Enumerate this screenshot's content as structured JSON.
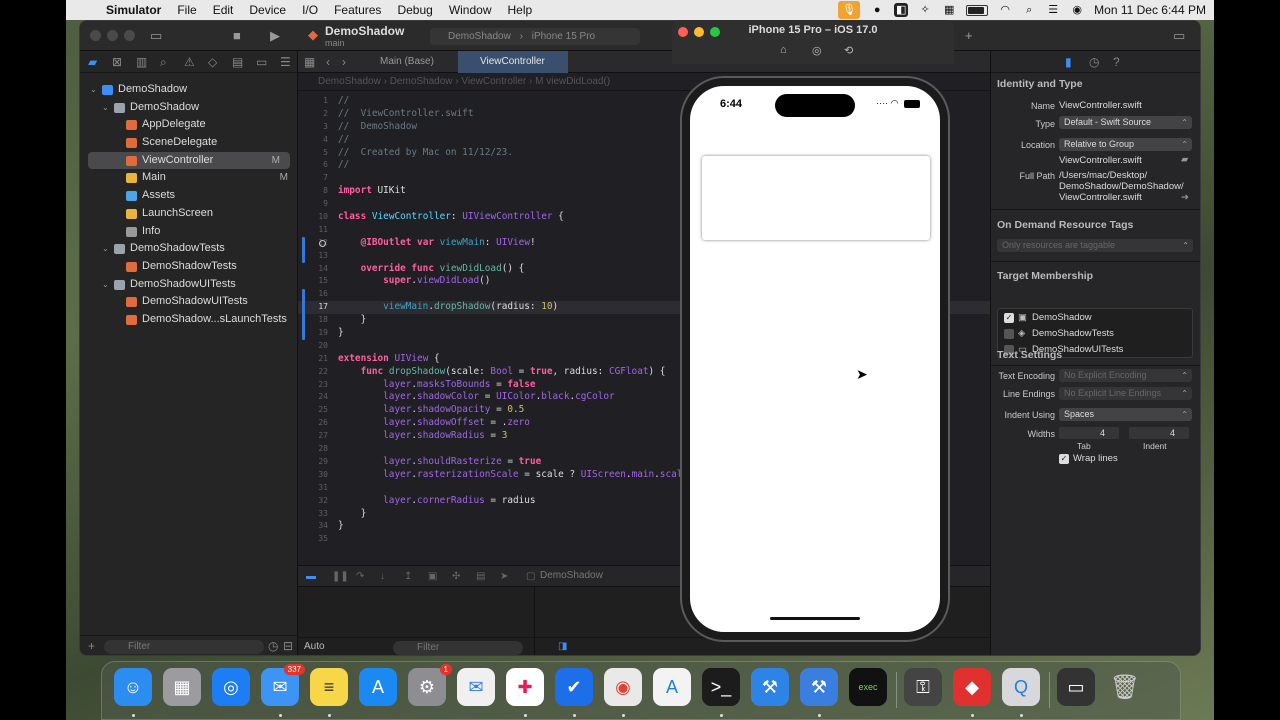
{
  "menubar": {
    "app_name": "Simulator",
    "items": [
      "File",
      "Edit",
      "Device",
      "I/O",
      "Features",
      "Debug",
      "Window",
      "Help"
    ],
    "clock": "Mon 11 Dec  6:44 PM"
  },
  "xcode": {
    "project_title": "DemoShadow",
    "branch": "main",
    "scheme": "DemoShadow",
    "destination": "iPhone 15 Pro"
  },
  "navigator": {
    "filter_placeholder": "Filter",
    "items": [
      {
        "label": "DemoShadow",
        "level": 0,
        "kind": "project",
        "expanded": true,
        "badge": ""
      },
      {
        "label": "DemoShadow",
        "level": 1,
        "kind": "folder",
        "expanded": true,
        "badge": ""
      },
      {
        "label": "AppDelegate",
        "level": 2,
        "kind": "swift",
        "badge": ""
      },
      {
        "label": "SceneDelegate",
        "level": 2,
        "kind": "swift",
        "badge": ""
      },
      {
        "label": "ViewController",
        "level": 2,
        "kind": "swift",
        "badge": "M",
        "selected": true
      },
      {
        "label": "Main",
        "level": 2,
        "kind": "storyboard",
        "badge": "M"
      },
      {
        "label": "Assets",
        "level": 2,
        "kind": "assets",
        "badge": ""
      },
      {
        "label": "LaunchScreen",
        "level": 2,
        "kind": "storyboard",
        "badge": ""
      },
      {
        "label": "Info",
        "level": 2,
        "kind": "plist",
        "badge": ""
      },
      {
        "label": "DemoShadowTests",
        "level": 1,
        "kind": "folder",
        "expanded": true,
        "badge": ""
      },
      {
        "label": "DemoShadowTests",
        "level": 2,
        "kind": "swift",
        "badge": ""
      },
      {
        "label": "DemoShadowUITests",
        "level": 1,
        "kind": "folder",
        "expanded": true,
        "badge": ""
      },
      {
        "label": "DemoShadowUITests",
        "level": 2,
        "kind": "swift",
        "badge": ""
      },
      {
        "label": "DemoShadow...sLaunchTests",
        "level": 2,
        "kind": "swift",
        "badge": ""
      }
    ]
  },
  "editor": {
    "tabs": [
      {
        "label": "Main (Base)",
        "active": false
      },
      {
        "label": "ViewController",
        "active": true
      }
    ],
    "jumpbar": "DemoShadow  ›  DemoShadow  ›  ViewController  ›  M  viewDidLoad()",
    "debug_scheme": "DemoShadow",
    "debug_filter_mode": "Auto",
    "debug_filter_placeholder": "Filter",
    "code_lines": [
      {
        "n": "1",
        "html": "<span class='cm'>//</span>"
      },
      {
        "n": "2",
        "html": "<span class='cm'>//  ViewController.swift</span>"
      },
      {
        "n": "3",
        "html": "<span class='cm'>//  DemoShadow</span>"
      },
      {
        "n": "4",
        "html": "<span class='cm'>//</span>"
      },
      {
        "n": "5",
        "html": "<span class='cm'>//  Created by Mac on 11/12/23.</span>"
      },
      {
        "n": "6",
        "html": "<span class='cm'>//</span>"
      },
      {
        "n": "7",
        "html": ""
      },
      {
        "n": "8",
        "html": "<span class='kw'>import</span> UIKit"
      },
      {
        "n": "9",
        "html": ""
      },
      {
        "n": "10",
        "html": "<span class='kw'>class</span> <span class='ty'>ViewController</span>: <span class='pr'>UIViewController</span> {"
      },
      {
        "n": "11",
        "html": ""
      },
      {
        "n": "12",
        "html": "    <span class='kw'>@IBOutlet</span> <span class='kw'>var</span> <span class='ou'>viewMain</span>: <span class='pr'>UIView</span>!",
        "outlet": true
      },
      {
        "n": "13",
        "html": ""
      },
      {
        "n": "14",
        "html": "    <span class='kw'>override</span> <span class='kw'>func</span> <span class='fn'>viewDidLoad</span>() {"
      },
      {
        "n": "15",
        "html": "        <span class='kw'>super</span>.<span class='pr'>viewDidLoad</span>()"
      },
      {
        "n": "16",
        "html": ""
      },
      {
        "n": "17",
        "html": "        <span class='ou'>viewMain</span>.<span class='fn'>dropShadow</span>(radius: <span class='nu'>10</span>)",
        "current": true
      },
      {
        "n": "18",
        "html": "    }"
      },
      {
        "n": "19",
        "html": "}"
      },
      {
        "n": "20",
        "html": ""
      },
      {
        "n": "21",
        "html": "<span class='kw'>extension</span> <span class='pr'>UIView</span> {"
      },
      {
        "n": "22",
        "html": "    <span class='kw'>func</span> <span class='fn'>dropShadow</span>(scale: <span class='pr'>Bool</span> = <span class='kw'>true</span>, radius: <span class='pr'>CGFloat</span>) {"
      },
      {
        "n": "23",
        "html": "        <span class='pr'>layer</span>.<span class='pr'>masksToBounds</span> = <span class='kw'>false</span>"
      },
      {
        "n": "24",
        "html": "        <span class='pr'>layer</span>.<span class='pr'>shadowColor</span> = <span class='pr'>UIColor</span>.<span class='pr'>black</span>.<span class='pr'>cgColor</span>"
      },
      {
        "n": "25",
        "html": "        <span class='pr'>layer</span>.<span class='pr'>shadowOpacity</span> = <span class='nu'>0.5</span>"
      },
      {
        "n": "26",
        "html": "        <span class='pr'>layer</span>.<span class='pr'>shadowOffset</span> = .<span class='pr'>zero</span>"
      },
      {
        "n": "27",
        "html": "        <span class='pr'>layer</span>.<span class='pr'>shadowRadius</span> = <span class='nu'>3</span>"
      },
      {
        "n": "28",
        "html": ""
      },
      {
        "n": "29",
        "html": "        <span class='pr'>layer</span>.<span class='pr'>shouldRasterize</span> = <span class='kw'>true</span>"
      },
      {
        "n": "30",
        "html": "        <span class='pr'>layer</span>.<span class='pr'>rasterizationScale</span> = scale ? <span class='pr'>UIScreen</span>.<span class='pr'>main</span>.<span class='pr'>scale</span>"
      },
      {
        "n": "31",
        "html": ""
      },
      {
        "n": "32",
        "html": "        <span class='pr'>layer</span>.<span class='pr'>cornerRadius</span> = radius"
      },
      {
        "n": "33",
        "html": "    }"
      },
      {
        "n": "34",
        "html": "}"
      },
      {
        "n": "35",
        "html": ""
      }
    ]
  },
  "inspector": {
    "identity_title": "Identity and Type",
    "name_label": "Name",
    "name_value": "ViewController.swift",
    "type_label": "Type",
    "type_value": "Default - Swift Source",
    "location_label": "Location",
    "location_value": "Relative to Group",
    "location_file": "ViewController.swift",
    "fullpath_label": "Full Path",
    "fullpath_line1": "/Users/mac/Desktop/",
    "fullpath_line2": "DemoShadow/DemoShadow/",
    "fullpath_line3": "ViewController.swift",
    "odr_title": "On Demand Resource Tags",
    "odr_placeholder": "Only resources are taggable",
    "membership_title": "Target Membership",
    "membership": [
      {
        "label": "DemoShadow",
        "checked": true
      },
      {
        "label": "DemoShadowTests",
        "checked": false
      },
      {
        "label": "DemoShadowUITests",
        "checked": false
      }
    ],
    "text_settings_title": "Text Settings",
    "encoding_label": "Text Encoding",
    "encoding_value": "No Explicit Encoding",
    "line_endings_label": "Line Endings",
    "line_endings_value": "No Explicit Line Endings",
    "indent_using_label": "Indent Using",
    "indent_using_value": "Spaces",
    "widths_label": "Widths",
    "tab_value": "4",
    "indent_value": "4",
    "tab_caption": "Tab",
    "indent_caption": "Indent",
    "wrap_label": "Wrap lines"
  },
  "simulator": {
    "title": "iPhone 15 Pro – iOS 17.0",
    "status_time": "6:44"
  },
  "dock": {
    "mail_badge": "337",
    "settings_badge": "1"
  }
}
